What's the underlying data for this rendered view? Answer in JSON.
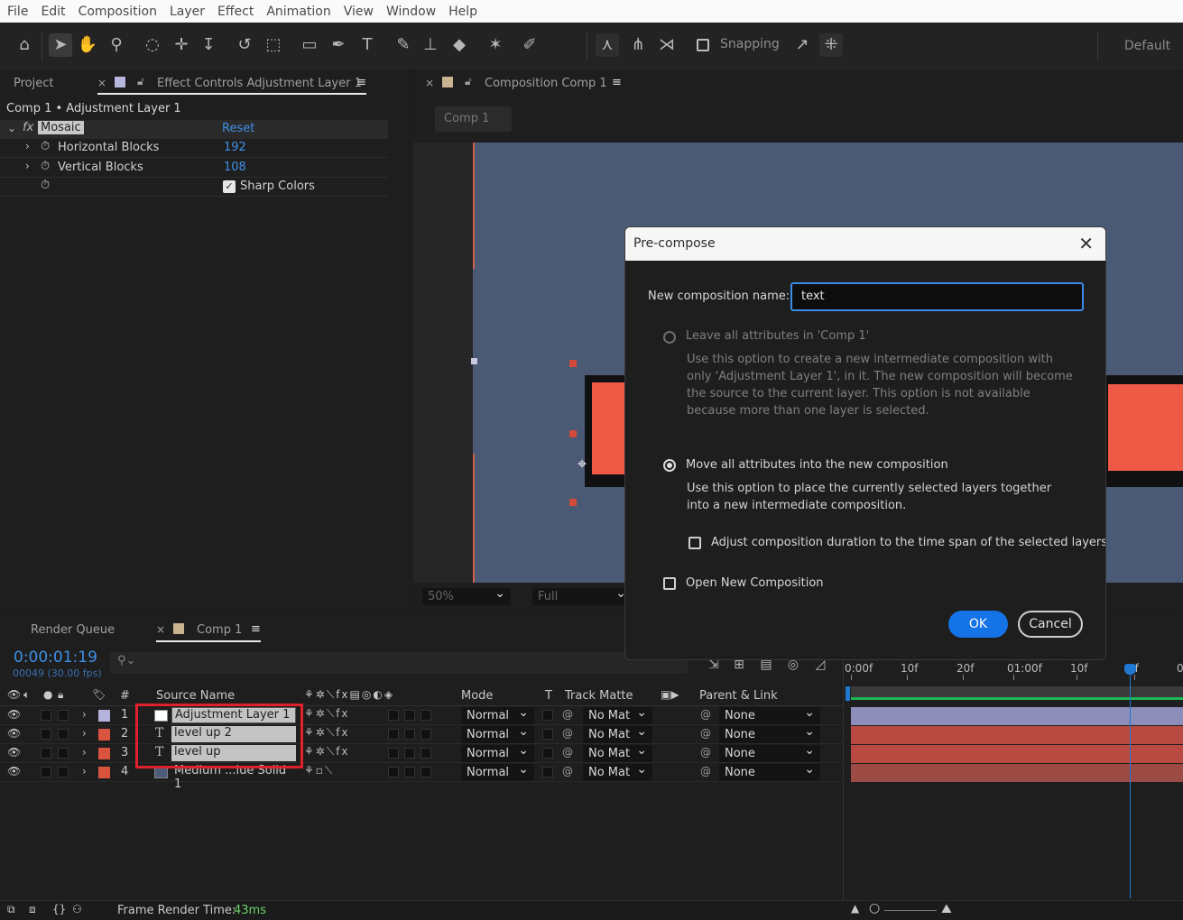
{
  "menu": [
    "File",
    "Edit",
    "Composition",
    "Layer",
    "Effect",
    "Animation",
    "View",
    "Window",
    "Help"
  ],
  "toolbar": {
    "snapping_label": "Snapping",
    "workspace_label": "Default"
  },
  "project_panel": {
    "tab_project": "Project",
    "tab_effect_controls": "Effect Controls Adjustment Layer 1",
    "breadcrumb": "Comp 1 • Adjustment Layer 1",
    "effect_name": "Mosaic",
    "reset_label": "Reset",
    "params": [
      {
        "label": "Horizontal Blocks",
        "value": "192"
      },
      {
        "label": "Vertical Blocks",
        "value": "108"
      }
    ],
    "sharp_colors_label": "Sharp Colors"
  },
  "comp_panel": {
    "tab_label": "Composition Comp 1",
    "sub_tab": "Comp 1",
    "zoom": "50%",
    "resolution": "Full"
  },
  "timeline": {
    "tab_render_queue": "Render Queue",
    "tab_comp": "Comp 1",
    "timecode": "0:00:01:19",
    "frames_fps": "00049 (30.00 fps)",
    "search_placeholder": "",
    "col_num": "#",
    "col_source": "Source Name",
    "col_mode": "Mode",
    "col_t": "T",
    "col_trackmatte": "Track Matte",
    "col_parent": "Parent & Link",
    "ruler": [
      "0:00f",
      "10f",
      "20f",
      "01:00f",
      "10f",
      "0f",
      "0"
    ],
    "layers": [
      {
        "num": "1",
        "name": "Adjustment Layer 1",
        "mode": "Normal",
        "matte": "No Mat",
        "parent": "None",
        "label_color": "#b3b3dd",
        "bar_color": "#8d8dba"
      },
      {
        "num": "2",
        "name": "level up 2",
        "mode": "Normal",
        "matte": "No Mat",
        "parent": "None",
        "label_color": "#d9533f",
        "bar_color": "#b94a42"
      },
      {
        "num": "3",
        "name": "level up",
        "mode": "Normal",
        "matte": "No Mat",
        "parent": "None",
        "label_color": "#d9533f",
        "bar_color": "#b94a42"
      },
      {
        "num": "4",
        "name": "Medium ...lue Solid 1",
        "mode": "Normal",
        "matte": "No Mat",
        "parent": "None",
        "label_color": "#d9533f",
        "bar_color": "#9c4a44"
      }
    ],
    "footer_label": "Frame Render Time:",
    "footer_value": "43ms"
  },
  "dialog": {
    "title": "Pre-compose",
    "name_label": "New composition name:",
    "name_value": "text",
    "opt1_label": "Leave all attributes in 'Comp 1'",
    "opt1_desc": "Use this option to create a new intermediate composition with only 'Adjustment Layer 1', in it. The new composition will become the source to the current layer. This option is not available because more than one layer is selected.",
    "opt2_label": "Move all attributes into the new composition",
    "opt2_desc": "Use this option to place the currently selected layers together into a new intermediate composition.",
    "adjust_label": "Adjust composition duration to the time span of the selected layers",
    "open_label": "Open New Composition",
    "ok": "OK",
    "cancel": "Cancel"
  },
  "colors": {
    "accent": "#1473e6",
    "highlight_box": "#e0202a",
    "comp_bg": "#4a5a74",
    "text_red": "#ef5a47"
  }
}
